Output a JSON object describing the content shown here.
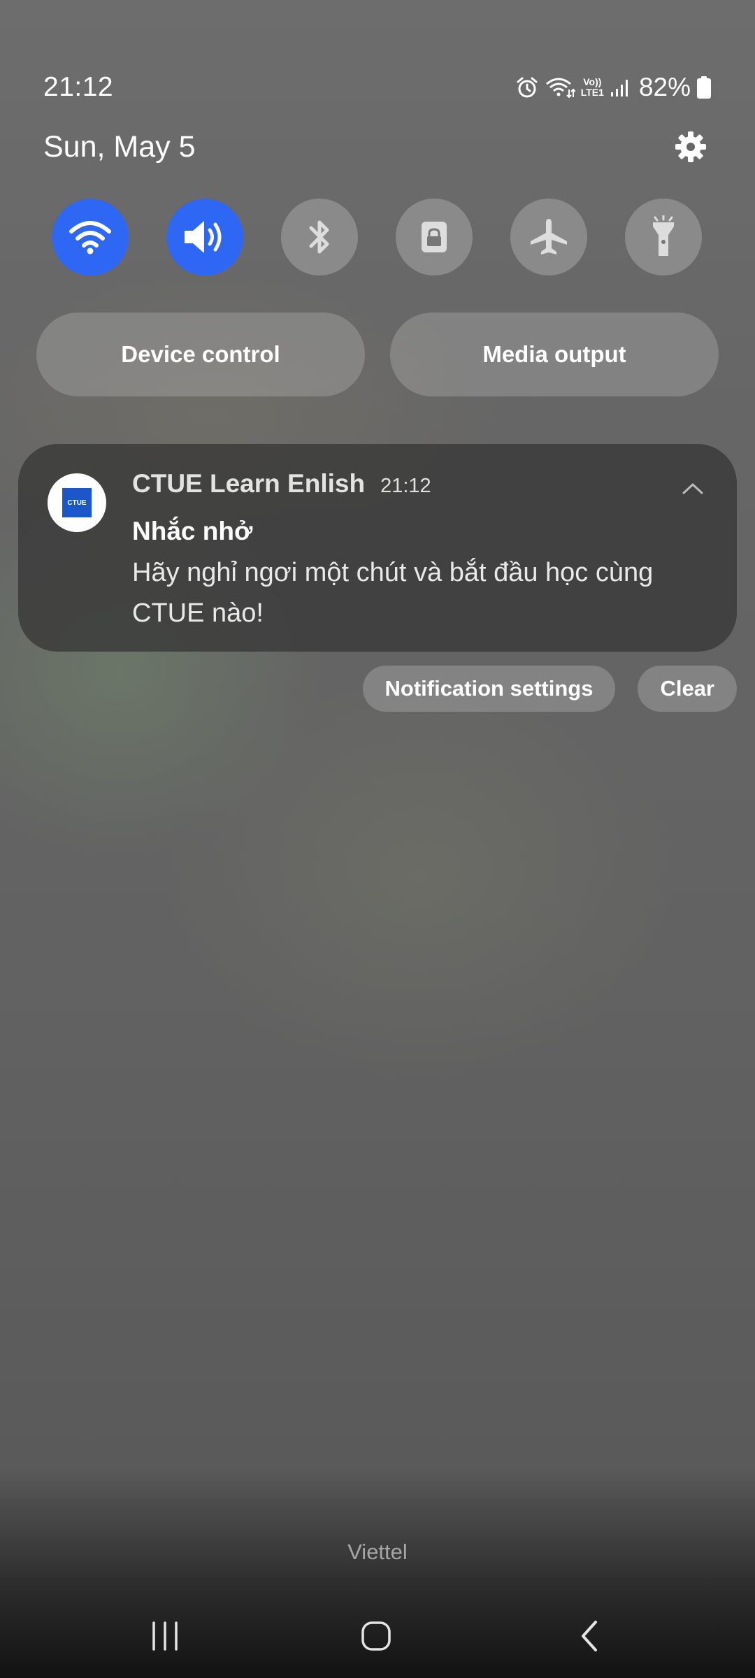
{
  "status_bar": {
    "time": "21:12",
    "volte_top": "Vo))",
    "volte_bottom": "LTE1",
    "battery_percent": "82%",
    "icons": [
      "alarm-icon",
      "wifi-calling-icon",
      "volte-icon",
      "signal-icon",
      "battery-icon"
    ]
  },
  "header": {
    "date": "Sun, May 5",
    "settings_icon": "gear-icon"
  },
  "quick_toggles": [
    {
      "name": "wifi",
      "icon": "wifi-icon",
      "active": true
    },
    {
      "name": "sound",
      "icon": "speaker-icon",
      "active": true
    },
    {
      "name": "bluetooth",
      "icon": "bluetooth-icon",
      "active": false
    },
    {
      "name": "rotation-lock",
      "icon": "lock-icon",
      "active": false
    },
    {
      "name": "airplane-mode",
      "icon": "airplane-icon",
      "active": false
    },
    {
      "name": "flashlight",
      "icon": "flashlight-icon",
      "active": false
    }
  ],
  "pills": {
    "device_control": "Device control",
    "media_output": "Media output"
  },
  "notification": {
    "app_name": "CTUE Learn Enlish",
    "time": "21:12",
    "icon_text": "CTUE",
    "title": "Nhắc nhở",
    "body": "Hãy nghỉ ngơi một chút và bắt đầu học cùng CTUE nào!"
  },
  "notification_actions": {
    "settings": "Notification settings",
    "clear": "Clear"
  },
  "carrier": "Viettel",
  "colors": {
    "toggle_active": "#2f67f5",
    "toggle_inactive": "rgba(255,255,255,0.22)",
    "app_icon_blue": "#1b57c9"
  },
  "nav_bar": {
    "icons": [
      "recents-icon",
      "home-icon",
      "back-icon"
    ]
  }
}
